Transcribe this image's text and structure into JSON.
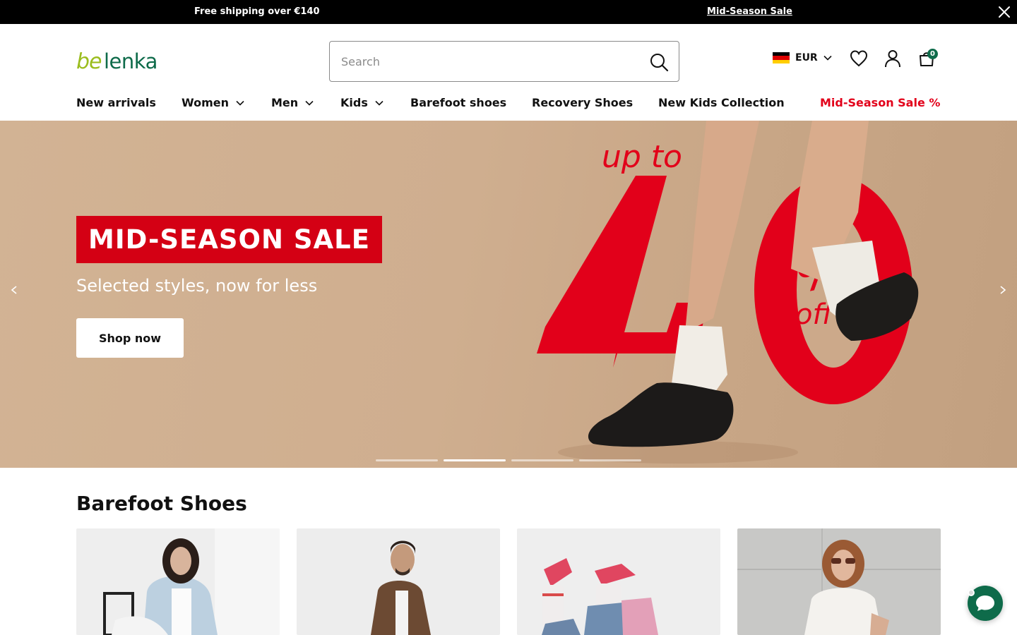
{
  "topbar": {
    "shipping_text": "Free shipping over €140",
    "sale_link": "Mid-Season Sale"
  },
  "header": {
    "logo_text": "be lenka",
    "search_placeholder": "Search",
    "currency": "EUR",
    "cart_count": "0"
  },
  "nav": {
    "items": [
      {
        "label": "New arrivals"
      },
      {
        "label": "Women"
      },
      {
        "label": "Men"
      },
      {
        "label": "Kids"
      },
      {
        "label": "Barefoot shoes"
      },
      {
        "label": "Recovery Shoes"
      },
      {
        "label": "New Kids Collection"
      },
      {
        "label": "Mid-Season Sale %"
      }
    ]
  },
  "hero": {
    "title": "MID-SEASON SALE",
    "subtitle": "Selected styles, now for less",
    "cta": "Shop now",
    "art_top": "up to",
    "art_number": "40",
    "art_percent": "%",
    "art_off": "off",
    "slides_total": 4,
    "active_slide": 2
  },
  "section": {
    "title": "Barefoot Shoes"
  },
  "colors": {
    "brand_green": "#0e6b4a",
    "logo_lime": "#9bbd1e",
    "sale_red": "#e2001a",
    "hero_bg": "#cfae8f"
  }
}
